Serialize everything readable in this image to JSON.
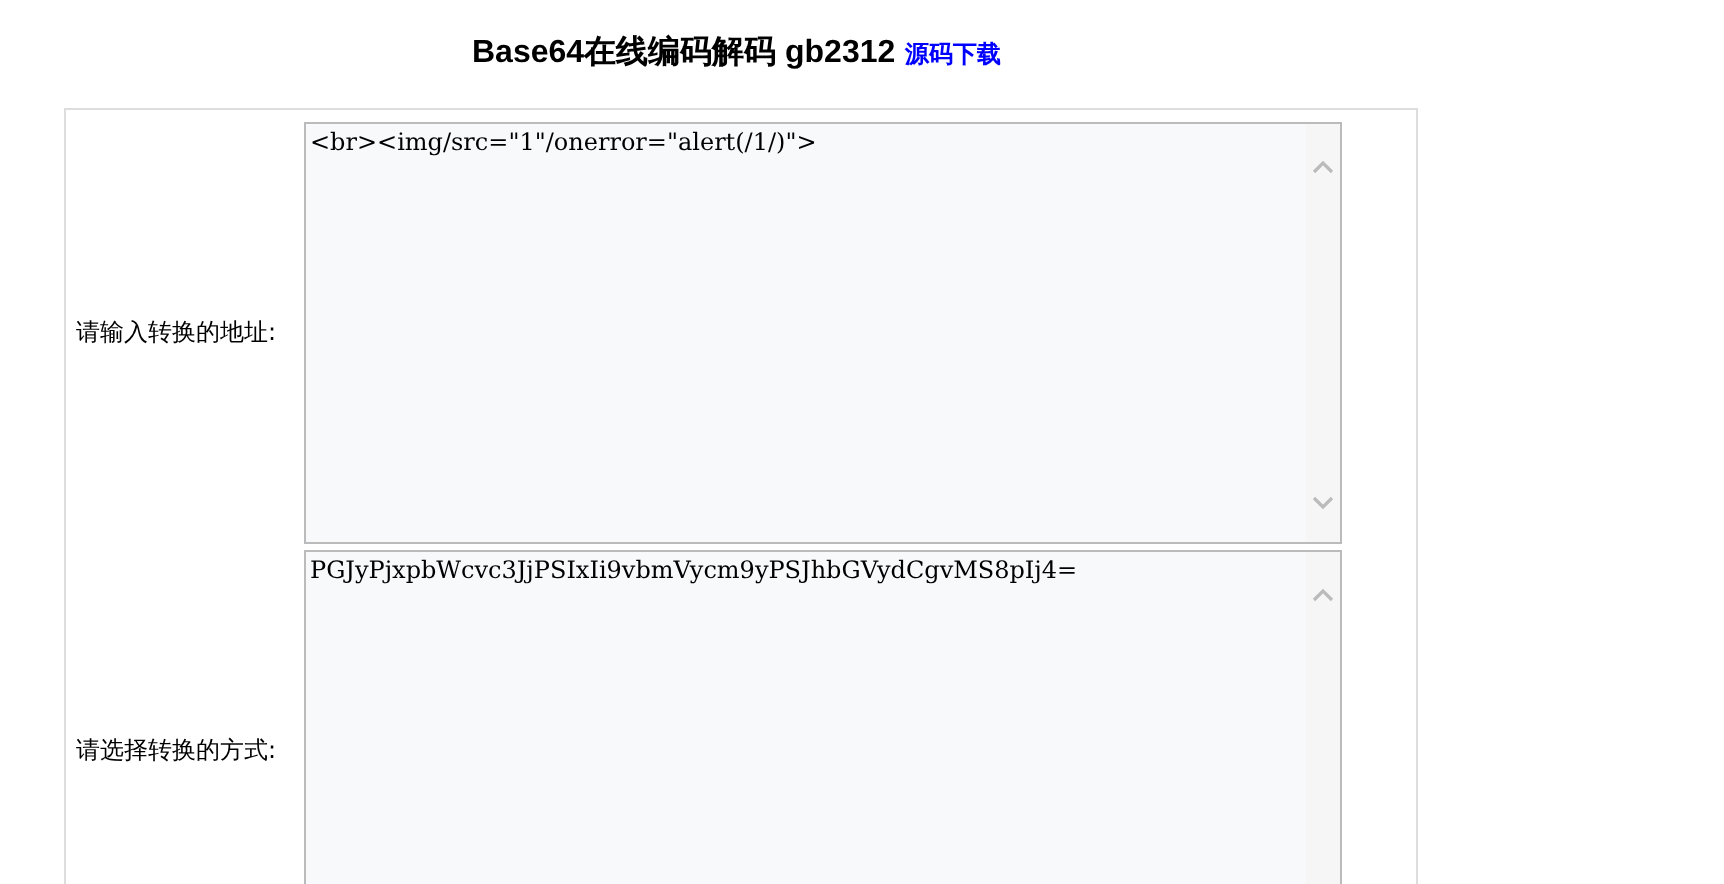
{
  "header": {
    "title": "Base64在线编码解码 gb2312",
    "link": "源码下载"
  },
  "rows": [
    {
      "label": "请输入转换的地址:",
      "value": "<br><img/src=\"1\"/onerror=\"alert(/1/)\">"
    },
    {
      "label": "请选择转换的方式:",
      "value": "PGJyPjxpbWcvc3JjPSIxIi9vbmVycm9yPSJhbGVydCgvMS8pIj4="
    }
  ]
}
